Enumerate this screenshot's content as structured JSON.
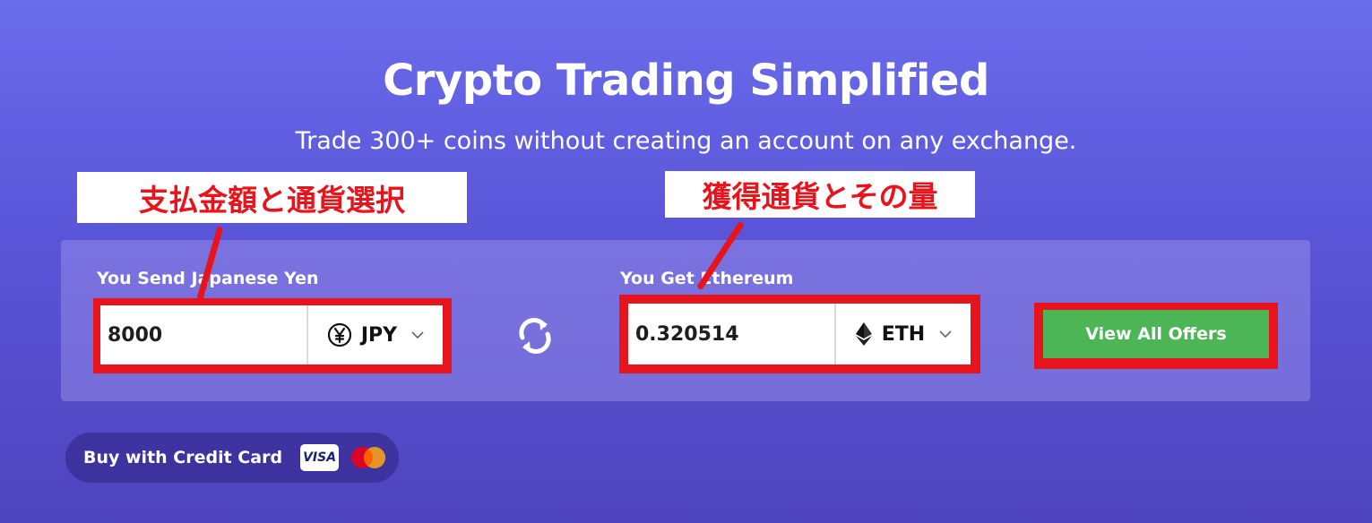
{
  "hero": {
    "title": "Crypto Trading Simplified",
    "subtitle": "Trade 300+ coins without creating an account on any exchange."
  },
  "annotations": {
    "left_label": "支払金額と通貨選択",
    "right_label": "獲得通貨とその量",
    "color": "#e8141c"
  },
  "send": {
    "label": "You Send Japanese Yen",
    "amount": "8000",
    "currency_code": "JPY",
    "currency_icon": "yen-icon"
  },
  "swap": {
    "icon": "swap-arrows-icon"
  },
  "get": {
    "label": "You Get Ethereum",
    "amount": "0.320514",
    "currency_code": "ETH",
    "currency_icon": "ethereum-icon"
  },
  "offers": {
    "button_label": "View All Offers",
    "color": "#4cb556"
  },
  "credit_card": {
    "label": "Buy with Credit Card",
    "visa": "VISA",
    "mastercard_icon": "mastercard-icon"
  }
}
